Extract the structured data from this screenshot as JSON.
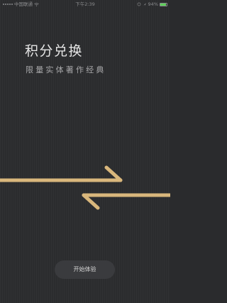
{
  "status_bar": {
    "carrier": "中国联通",
    "time": "下午2:39",
    "battery": "94%",
    "battery_level": 0.94,
    "icons": [
      "signal-icon",
      "wifi-icon",
      "location-icon",
      "alarm-icon",
      "battery-icon"
    ]
  },
  "hero": {
    "title": "积分兑换",
    "subtitle": "限量实体著作经典"
  },
  "exchange_graphic": {
    "icon": "exchange-arrows-icon",
    "color": "#d9b77c"
  },
  "actions": {
    "start_label": "开始体验"
  },
  "colors": {
    "background": "#2b2c2e",
    "accent": "#d9b77c",
    "button_bg": "#3a3b3e",
    "battery_green": "#5fd15c"
  }
}
